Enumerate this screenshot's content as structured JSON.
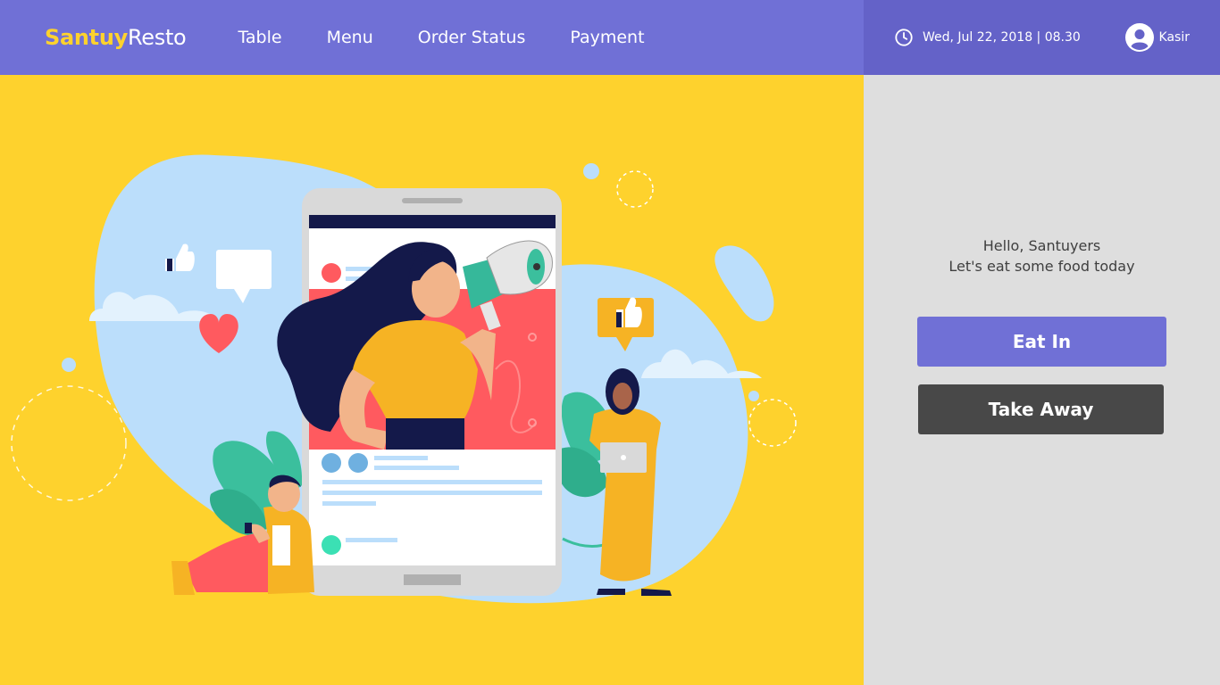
{
  "brand": {
    "part1": "Santuy",
    "part2": "Resto"
  },
  "nav": [
    {
      "label": "Table"
    },
    {
      "label": "Menu"
    },
    {
      "label": "Order Status"
    },
    {
      "label": "Payment"
    }
  ],
  "header": {
    "datetime": "Wed, Jul 22, 2018 | 08.30",
    "user": "Kasir"
  },
  "panel": {
    "greeting_line1": "Hello, Santuyers",
    "greeting_line2": "Let's eat some food today",
    "eat_in_label": "Eat In",
    "take_away_label": "Take Away"
  },
  "colors": {
    "primary": "#7070d6",
    "header_right": "#6462c8",
    "brand_accent": "#fed22d",
    "illustration_bg": "#fed22d",
    "panel_bg": "#dedede",
    "take_away": "#484848"
  },
  "icons": [
    "clock-icon",
    "user-avatar-icon"
  ]
}
